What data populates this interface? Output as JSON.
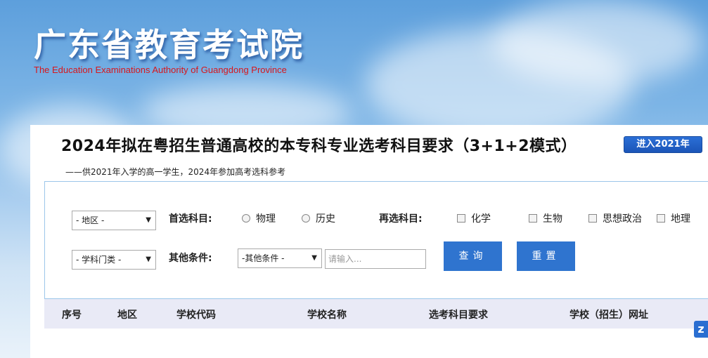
{
  "header": {
    "title": "广东省教育考试院",
    "subtitle": "The Education Examinations Authority of Guangdong Province"
  },
  "panel": {
    "title": "2024年拟在粤招生普通高校的本专科专业选考科目要求（3+1+2模式）",
    "switch_button": "进入2021年",
    "note": "——供2021年入学的高一学生，2024年参加高考选科参考"
  },
  "filters": {
    "region_select": "- 地区 -",
    "category_select": "- 学科门类 -",
    "primary_label": "首选科目:",
    "primary_options": [
      "物理",
      "历史"
    ],
    "reselect_label": "再选科目:",
    "reselect_options": [
      "化学",
      "生物",
      "思想政治",
      "地理"
    ],
    "other_label": "其他条件:",
    "other_select": "-其他条件 -",
    "input_placeholder": "请输入...",
    "query_button": "查询",
    "reset_button": "重置"
  },
  "table": {
    "headers": [
      "序号",
      "地区",
      "学校代码",
      "学校名称",
      "选考科目要求",
      "学校（招生）网址"
    ]
  },
  "side_icon": "zhihu-like-icon"
}
